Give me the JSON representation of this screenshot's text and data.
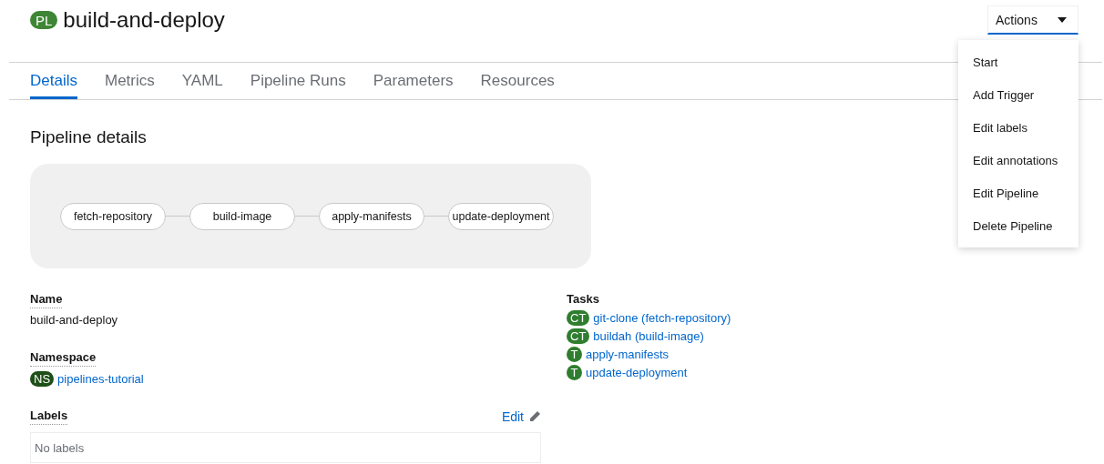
{
  "header": {
    "badge": "PL",
    "title": "build-and-deploy",
    "actions_button": "Actions"
  },
  "actions_menu": [
    "Start",
    "Add Trigger",
    "Edit labels",
    "Edit annotations",
    "Edit Pipeline",
    "Delete Pipeline"
  ],
  "tabs": [
    {
      "label": "Details",
      "selected": true
    },
    {
      "label": "Metrics",
      "selected": false
    },
    {
      "label": "YAML",
      "selected": false
    },
    {
      "label": "Pipeline Runs",
      "selected": false
    },
    {
      "label": "Parameters",
      "selected": false
    },
    {
      "label": "Resources",
      "selected": false
    }
  ],
  "section_title": "Pipeline details",
  "pipeline_graph": [
    "fetch-repository",
    "build-image",
    "apply-manifests",
    "update-deployment"
  ],
  "details": {
    "name_label": "Name",
    "name": "build-and-deploy",
    "namespace_label": "Namespace",
    "namespace_badge": "NS",
    "namespace": "pipelines-tutorial",
    "labels_label": "Labels",
    "labels_edit": "Edit",
    "labels_empty": "No labels"
  },
  "tasks": {
    "label": "Tasks",
    "items": [
      {
        "badge": "CT",
        "name": "git-clone (fetch-repository)"
      },
      {
        "badge": "CT",
        "name": "buildah (build-image)"
      },
      {
        "badge": "T",
        "name": "apply-manifests"
      },
      {
        "badge": "T",
        "name": "update-deployment"
      }
    ]
  }
}
